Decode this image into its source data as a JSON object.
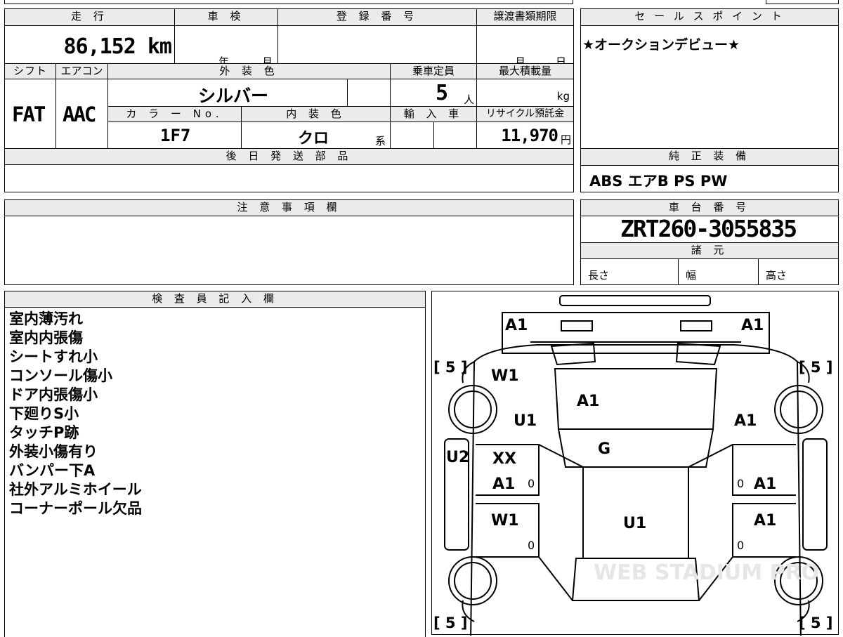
{
  "summary": {
    "mileage_label": "走 行",
    "mileage_value": "86,152 km",
    "shaken_label": "車 検",
    "shaken_year_unit": "年",
    "shaken_month_unit": "月",
    "registration_label": "登 録 番 号",
    "transfer_deadline_label": "譲渡書類期限",
    "transfer_month_unit": "月",
    "transfer_day_unit": "日",
    "shift_label": "シフト",
    "shift_value": "FAT",
    "aircon_label": "エアコン",
    "aircon_value": "AAC",
    "exterior_color_label": "外 装 色",
    "exterior_color_value": "シルバー",
    "capacity_label": "乗車定員",
    "capacity_value": "5",
    "capacity_unit": "人",
    "max_load_label": "最大積載量",
    "max_load_unit": "kg",
    "color_no_label": "カ ラ ー No.",
    "color_no_value": "1F7",
    "interior_color_label": "内 装 色",
    "interior_color_value": "クロ",
    "interior_color_suffix": "系",
    "import_label": "輸 入 車",
    "recycle_label": "リサイクル預託金",
    "recycle_value": "11,970",
    "recycle_unit": "円",
    "later_parts_label": "後 日 発 送 部 品"
  },
  "sales_point": {
    "label": "セ ー ル ス ポ イ ン ト",
    "text": "★オークションデビュー★"
  },
  "genuine_equipment": {
    "label": "純 正 装 備",
    "value": "ABS エアB PS PW"
  },
  "notes": {
    "label": "注 意 事 項 欄"
  },
  "chassis": {
    "label": "車 台 番 号",
    "value": "ZRT260-3055835",
    "specs_label": "諸 元",
    "length_label": "長さ",
    "width_label": "幅",
    "height_label": "高さ"
  },
  "inspector": {
    "label": "検 査 員 記 入 欄",
    "lines": [
      "室内薄汚れ",
      "室内内張傷",
      "シートすれ小",
      "コンソール傷小",
      "ドア内張傷小",
      "下廻りS小",
      "タッチP跡",
      "外装小傷有り",
      "バンパー下A",
      "社外アルミホイール",
      "コーナーポール欠品"
    ]
  },
  "diagram": {
    "front_left": "A1",
    "front_right": "A1",
    "hood": "A1",
    "windshield_label": "W1",
    "left_front_fender": "U1",
    "right_front_fender": "A1",
    "glass": "G",
    "left_pillar": "U2",
    "left_front_door_1": "XX",
    "left_front_door_2": "A1",
    "right_front_door": "A1",
    "left_rear_door": "W1",
    "right_rear_door": "A1",
    "roof": "U1",
    "tire_fl": "[ 5 ]",
    "tire_fr": "[ 5 ]",
    "tire_rl": "[ 5 ]",
    "tire_rr": "[ 5 ]",
    "zero_a": "0",
    "zero_b": "0",
    "zero_c": "0",
    "zero_d": "0",
    "watermark": "WEB STADIUM PRO"
  }
}
